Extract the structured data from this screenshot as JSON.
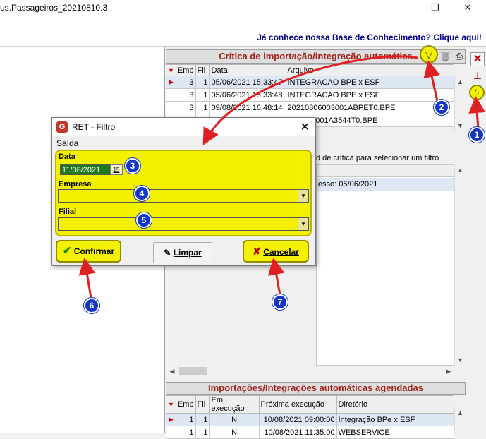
{
  "window": {
    "title": "us.Passageiros_20210810.3",
    "minimize": "—",
    "restore": "❐",
    "close": "✕"
  },
  "kb_link": "Já conhece nossa Base de Conhecimento? Clique aqui!",
  "import_panel": {
    "title": "Crítica de importação/integração automática",
    "columns": [
      "Emp",
      "Fil",
      "Data",
      "Arquivo"
    ],
    "rows": [
      {
        "emp": "3",
        "fil": "1",
        "data": "05/06/2021 15:33:47",
        "arquivo": "INTEGRACAO BPE x ESF",
        "selected": true
      },
      {
        "emp": "3",
        "fil": "1",
        "data": "05/06/2021 15:33:48",
        "arquivo": "INTEGRACAO BPE x ESF",
        "selected": false
      },
      {
        "emp": "3",
        "fil": "1",
        "data": "09/08/2021 16:48:14",
        "arquivo": "20210806003001ABPET0.BPE",
        "selected": false
      },
      {
        "emp": "",
        "fil": "",
        "data": "",
        "arquivo": "...06003001A3544T0.BPE",
        "selected": false
      }
    ],
    "hint": "d de crítica para selecionar um filtro",
    "detail_text": "esso: 05/06/2021"
  },
  "sched_panel": {
    "title": "Importações/Integrações automáticas agendadas",
    "columns": [
      "Emp",
      "Fil",
      "Em execução",
      "Próxima execução",
      "Diretório"
    ],
    "rows": [
      {
        "emp": "1",
        "fil": "1",
        "exec": "N",
        "prox": "10/08/2021 09:00:00",
        "dir": "Integração BPe x ESF",
        "selected": true
      },
      {
        "emp": "1",
        "fil": "1",
        "exec": "N",
        "prox": "10/08/2021 11:35:00",
        "dir": "WEBSERVICE",
        "selected": false
      }
    ]
  },
  "dialog": {
    "title": "RET - Filtro",
    "menu": "Saída",
    "data_label": "Data",
    "date_value": "11/08/2021",
    "cal_label": "15",
    "empresa_label": "Empresa",
    "filial_label": "Filial",
    "confirm": "Confirmar",
    "clear": "Limpar",
    "cancel": "Cancelar"
  },
  "badges": [
    "1",
    "2",
    "3",
    "4",
    "5",
    "6",
    "7"
  ],
  "colors": {
    "highlight": "#f3f000",
    "panel_title": "#a0201a",
    "badge": "#1336c8",
    "arrow": "#e02020"
  }
}
